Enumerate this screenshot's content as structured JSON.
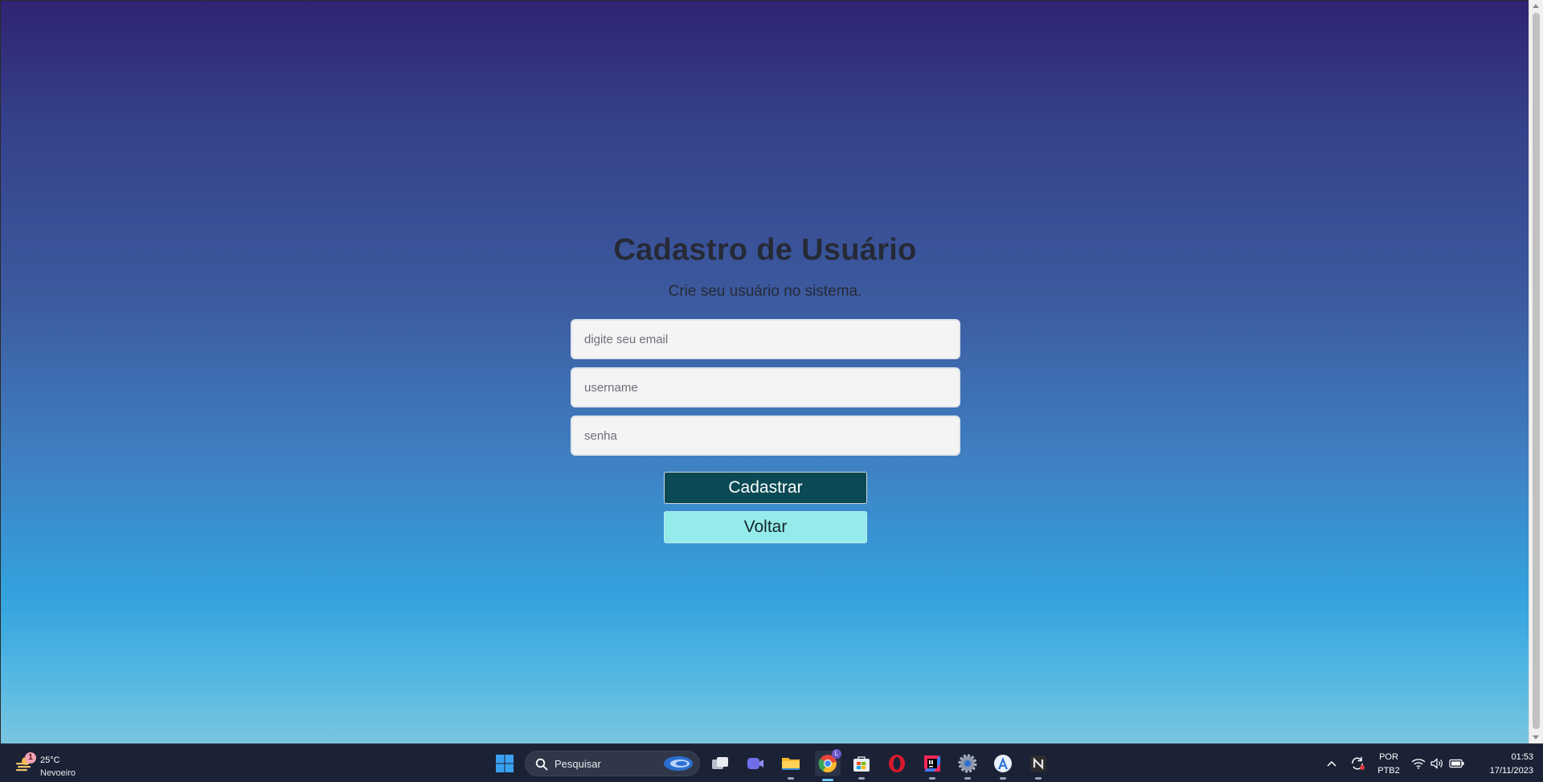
{
  "page": {
    "title": "Cadastro de Usuário",
    "subtitle": "Crie seu usuário no sistema."
  },
  "form": {
    "email_placeholder": "digite seu email",
    "username_placeholder": "username",
    "password_placeholder": "senha",
    "submit_label": "Cadastrar",
    "back_label": "Voltar"
  },
  "colors": {
    "submit_bg": "#0b4a54",
    "back_bg": "#94ebea",
    "gradient_top": "#2f2374",
    "gradient_bottom": "#79c5df"
  },
  "taskbar": {
    "weather_badge": "1",
    "weather_temp": "25°C",
    "weather_desc": "Nevoeiro",
    "search_label": "Pesquisar",
    "chrome_badge": "L",
    "apps": [
      "windows-start-icon",
      "task-view-icon",
      "meet-icon",
      "file-explorer-icon",
      "chrome-icon",
      "store-icon",
      "opera-icon",
      "intellij-icon",
      "settings-icon",
      "android-studio-icon",
      "notion-icon"
    ],
    "lang_top": "POR",
    "lang_bottom": "PTB2",
    "time": "01:53",
    "date": "17/11/2023"
  }
}
